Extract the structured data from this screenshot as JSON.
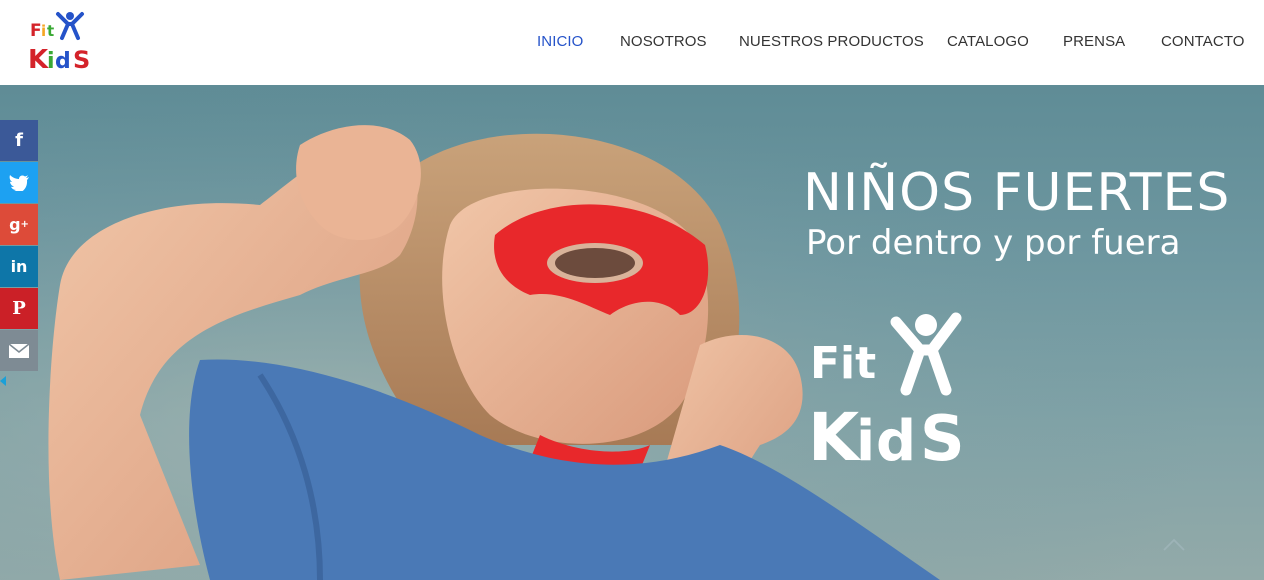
{
  "header": {
    "logo_text": "Fit Kids",
    "nav": [
      {
        "label": "INICIO",
        "active": true
      },
      {
        "label": "NOSOTROS",
        "active": false
      },
      {
        "label": "NUESTROS PRODUCTOS",
        "active": false
      },
      {
        "label": "CATALOGO",
        "active": false
      },
      {
        "label": "PRENSA",
        "active": false
      },
      {
        "label": "CONTACTO",
        "active": false
      }
    ]
  },
  "hero": {
    "headline": "NIÑOS FUERTES",
    "subline": "Por dentro y por fuera",
    "logo_text": "Fit Kids"
  },
  "social": {
    "items": [
      {
        "name": "facebook-icon",
        "glyph": "f",
        "color": "#3b5998"
      },
      {
        "name": "twitter-icon",
        "glyph": "t",
        "color": "#1da1f2"
      },
      {
        "name": "google-plus-icon",
        "glyph": "g+",
        "color": "#dd4b39"
      },
      {
        "name": "linkedin-icon",
        "glyph": "in",
        "color": "#0e76a8"
      },
      {
        "name": "pinterest-icon",
        "glyph": "P",
        "color": "#cb2027"
      },
      {
        "name": "email-icon",
        "glyph": "✉",
        "color": "#7e8b94"
      }
    ]
  },
  "colors": {
    "nav_active": "#2553c9",
    "nav_text": "#333333",
    "hero_sky": "#6e97a0",
    "mask_red": "#e8282b",
    "shirt_blue": "#4a79b6"
  }
}
